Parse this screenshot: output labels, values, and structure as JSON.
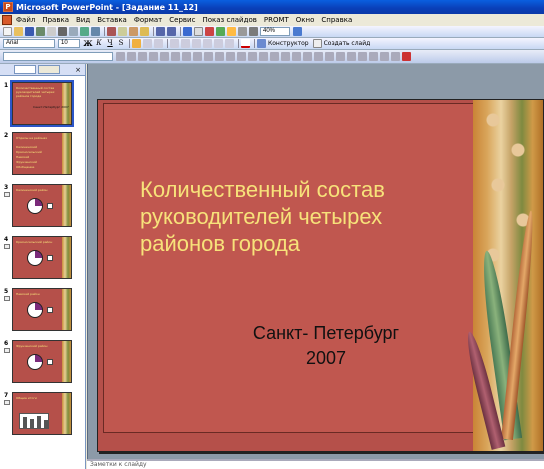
{
  "window": {
    "title": "Microsoft PowerPoint - [Задание 11_12]"
  },
  "menu": [
    "Файл",
    "Правка",
    "Вид",
    "Вставка",
    "Формат",
    "Сервис",
    "Показ слайдов",
    "PROMT",
    "Окно",
    "Справка"
  ],
  "toolbar": {
    "zoom": "40%",
    "font_name": "Arial",
    "font_size": "10",
    "bold": "Ж",
    "italic": "К",
    "underline": "Ч",
    "shadow": "S",
    "designer_label": "Конструктор",
    "new_slide_label": "Создать слайд"
  },
  "thumbnails": [
    {
      "num": "1",
      "title": "Количественный состав руководителей четырех районов города",
      "sub": "Санкт-Петербург 2007"
    },
    {
      "num": "2",
      "title": "Отделы на районах",
      "list": [
        "Калининский",
        "Красносельский",
        "Невский",
        "Фрунзенский",
        "Обобщение"
      ]
    },
    {
      "num": "3",
      "title": "Калининский район"
    },
    {
      "num": "4",
      "title": "Красносельский район"
    },
    {
      "num": "5",
      "title": "Невский район"
    },
    {
      "num": "6",
      "title": "Фрунзенский район"
    },
    {
      "num": "7",
      "title": "Общие итоги"
    }
  ],
  "slide": {
    "title": "Количественный состав руководителей четырех районов города",
    "subtitle_line1": "Санкт- Петербург",
    "subtitle_line2": "2007"
  },
  "notes": {
    "placeholder": "Заметки к слайду"
  },
  "colors": {
    "slide_bg": "#b5504a",
    "title_text": "#f7e27a",
    "workspace_bg": "#8c9aa8"
  }
}
